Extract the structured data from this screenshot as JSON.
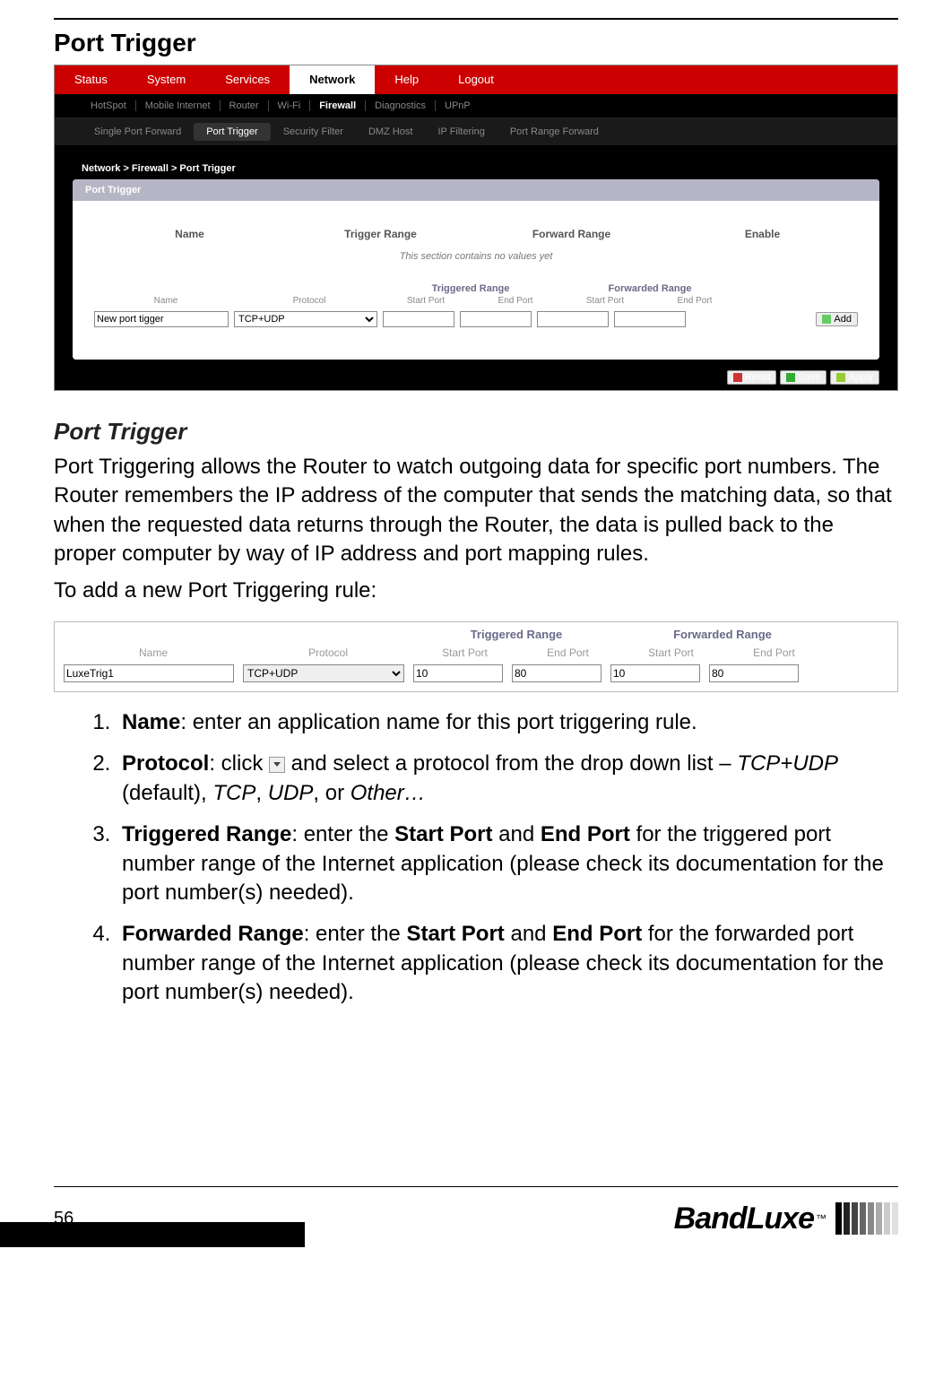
{
  "page_number": "56",
  "heading_main": "Port Trigger",
  "router_ui": {
    "nav1": [
      "Status",
      "System",
      "Services",
      "Network",
      "Help",
      "Logout"
    ],
    "nav1_active": "Network",
    "nav2": [
      "HotSpot",
      "Mobile Internet",
      "Router",
      "Wi-Fi",
      "Firewall",
      "Diagnostics",
      "UPnP"
    ],
    "nav2_active": "Firewall",
    "nav3": [
      "Single Port Forward",
      "Port Trigger",
      "Security Filter",
      "DMZ Host",
      "IP Filtering",
      "Port Range Forward"
    ],
    "nav3_active": "Port Trigger",
    "breadcrumb": "Network > Firewall > Port Trigger",
    "panel_title": "Port Trigger",
    "table_cols": [
      "Name",
      "Trigger Range",
      "Forward Range",
      "Enable"
    ],
    "empty_msg": "This section contains no values yet",
    "group_headers": {
      "triggered": "Triggered Range",
      "forwarded": "Forwarded Range"
    },
    "sub_headers": {
      "name": "Name",
      "protocol": "Protocol",
      "start_port": "Start Port",
      "end_port": "End Port"
    },
    "form": {
      "name_value": "New port tigger",
      "protocol_value": "TCP+UDP",
      "trig_start": "",
      "trig_end": "",
      "fwd_start": "",
      "fwd_end": ""
    },
    "buttons": {
      "add": "Add",
      "reset": "Reset",
      "save": "Save",
      "apply": "Apply"
    }
  },
  "section2_heading": "Port Trigger",
  "section2_para": "Port Triggering allows the Router to watch outgoing data for specific port numbers. The Router remembers the IP address of the computer that sends the matching data, so that when the requested data returns through the Router, the data is pulled back to the proper computer by way of IP address and port mapping rules.",
  "section2_para2": "To add a new Port Triggering rule:",
  "crop_form": {
    "group_triggered": "Triggered Range",
    "group_forwarded": "Forwarded Range",
    "col_name": "Name",
    "col_protocol": "Protocol",
    "col_start": "Start Port",
    "col_end": "End Port",
    "name_value": "LuxeTrig1",
    "protocol_value": "TCP+UDP",
    "trig_start": "10",
    "trig_end": "80",
    "fwd_start": "10",
    "fwd_end": "80"
  },
  "steps": {
    "s1_label": "Name",
    "s1_text": ": enter an application name for this port triggering rule.",
    "s2_label": "Protocol",
    "s2_text_a": ": click ",
    "s2_text_b": " and select a protocol from the drop down list – ",
    "s2_opt1": "TCP+UDP",
    "s2_opt1_suffix": " (default), ",
    "s2_opt2": "TCP",
    "s2_sep": ", ",
    "s2_opt3": "UDP",
    "s2_sep2": ", or ",
    "s2_opt4": "Other…",
    "s3_label": "Triggered Range",
    "s3_text_a": ": enter the ",
    "s3_sp": "Start Port",
    "s3_text_b": " and ",
    "s3_ep": "End Port",
    "s3_text_c": " for the triggered port number range of the Internet application (please check its documentation for the port number(s) needed).",
    "s4_label": "Forwarded Range",
    "s4_text_a": ": enter the ",
    "s4_sp": "Start Port",
    "s4_text_b": " and ",
    "s4_ep": "End Port",
    "s4_text_c": " for the forwarded port number range of the Internet application (please check its documentation for the port number(s) needed)."
  },
  "logo_text": "BandLuxe",
  "logo_tm": "™"
}
